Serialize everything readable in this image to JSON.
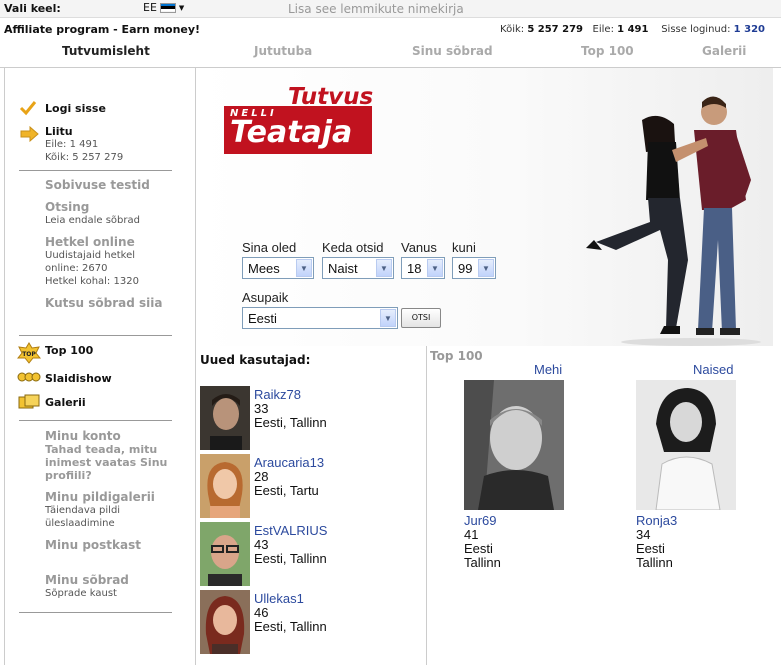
{
  "topbar": {
    "lang_label": "Vali keel:",
    "lang_code": "EE",
    "favorite": "Lisa see lemmikute nimekirja"
  },
  "affiliate": "Affiliate program - Earn money!",
  "stats": {
    "total_label": "Kõik:",
    "total": "5 257 279",
    "yesterday_label": "Eile:",
    "yesterday": "1 491",
    "logged_label": "Sisse loginud:",
    "logged": "1 320"
  },
  "nav": [
    "Tutvumisleht",
    "Jututuba",
    "Sinu sõbrad",
    "Top 100",
    "Galerii"
  ],
  "sidebar": {
    "login": "Logi sisse",
    "join": "Liitu",
    "join_yesterday": "Eile: 1 491",
    "join_total": "Kõik: 5 257 279",
    "tests": "Sobivuse testid",
    "search": "Otsing",
    "search_sub": "Leia endale sõbrad",
    "online": "Hetkel online",
    "online_sub1": "Uudistajaid hetkel",
    "online_sub2": "online: 2670",
    "online_sub3": "Hetkel kohal: 1320",
    "invite": "Kutsu sõbrad siia",
    "top100": "Top 100",
    "top100_badge": "TOP",
    "slideshow": "Slaidishow",
    "gallery": "Galerii",
    "account": "Minu konto",
    "account_sub1": "Tahad teada, mitu",
    "account_sub2": "inimest vaatas Sinu",
    "account_sub3": "profiili?",
    "mygallery": "Minu pildigalerii",
    "mygallery_sub1": "Täiendava pildi",
    "mygallery_sub2": "üleslaadimine",
    "mailbox": "Minu postkast",
    "friends": "Minu sõbrad",
    "friends_sub": "Sõprade kaust"
  },
  "logo": {
    "top": "Tutvus",
    "nelli": "NELLI",
    "main": "Teataja"
  },
  "search": {
    "you_label": "Sina oled",
    "you_value": "Mees",
    "seek_label": "Keda otsid",
    "seek_value": "Naist",
    "age_label": "Vanus",
    "age_from": "18",
    "to_label": "kuni",
    "age_to": "99",
    "place_label": "Asupaik",
    "place_value": "Eesti",
    "button": "OTSI"
  },
  "new_users": {
    "title": "Uued kasutajad:",
    "items": [
      {
        "name": "Raikz78",
        "age": "33",
        "location": "Eesti, Tallinn"
      },
      {
        "name": "Araucaria13",
        "age": "28",
        "location": "Eesti, Tartu"
      },
      {
        "name": "EstVALRIUS",
        "age": "43",
        "location": "Eesti, Tallinn"
      },
      {
        "name": "Ullekas1",
        "age": "46",
        "location": "Eesti, Tallinn"
      }
    ]
  },
  "top100": {
    "title": "Top 100",
    "men_label": "Mehi",
    "women_label": "Naised",
    "man": {
      "name": "Jur69",
      "age": "41",
      "country": "Eesti",
      "city": "Tallinn"
    },
    "woman": {
      "name": "Ronja3",
      "age": "34",
      "country": "Eesti",
      "city": "Tallinn"
    }
  },
  "colors": {
    "brand_red": "#c1121f",
    "link_blue": "#2c4a9e"
  }
}
